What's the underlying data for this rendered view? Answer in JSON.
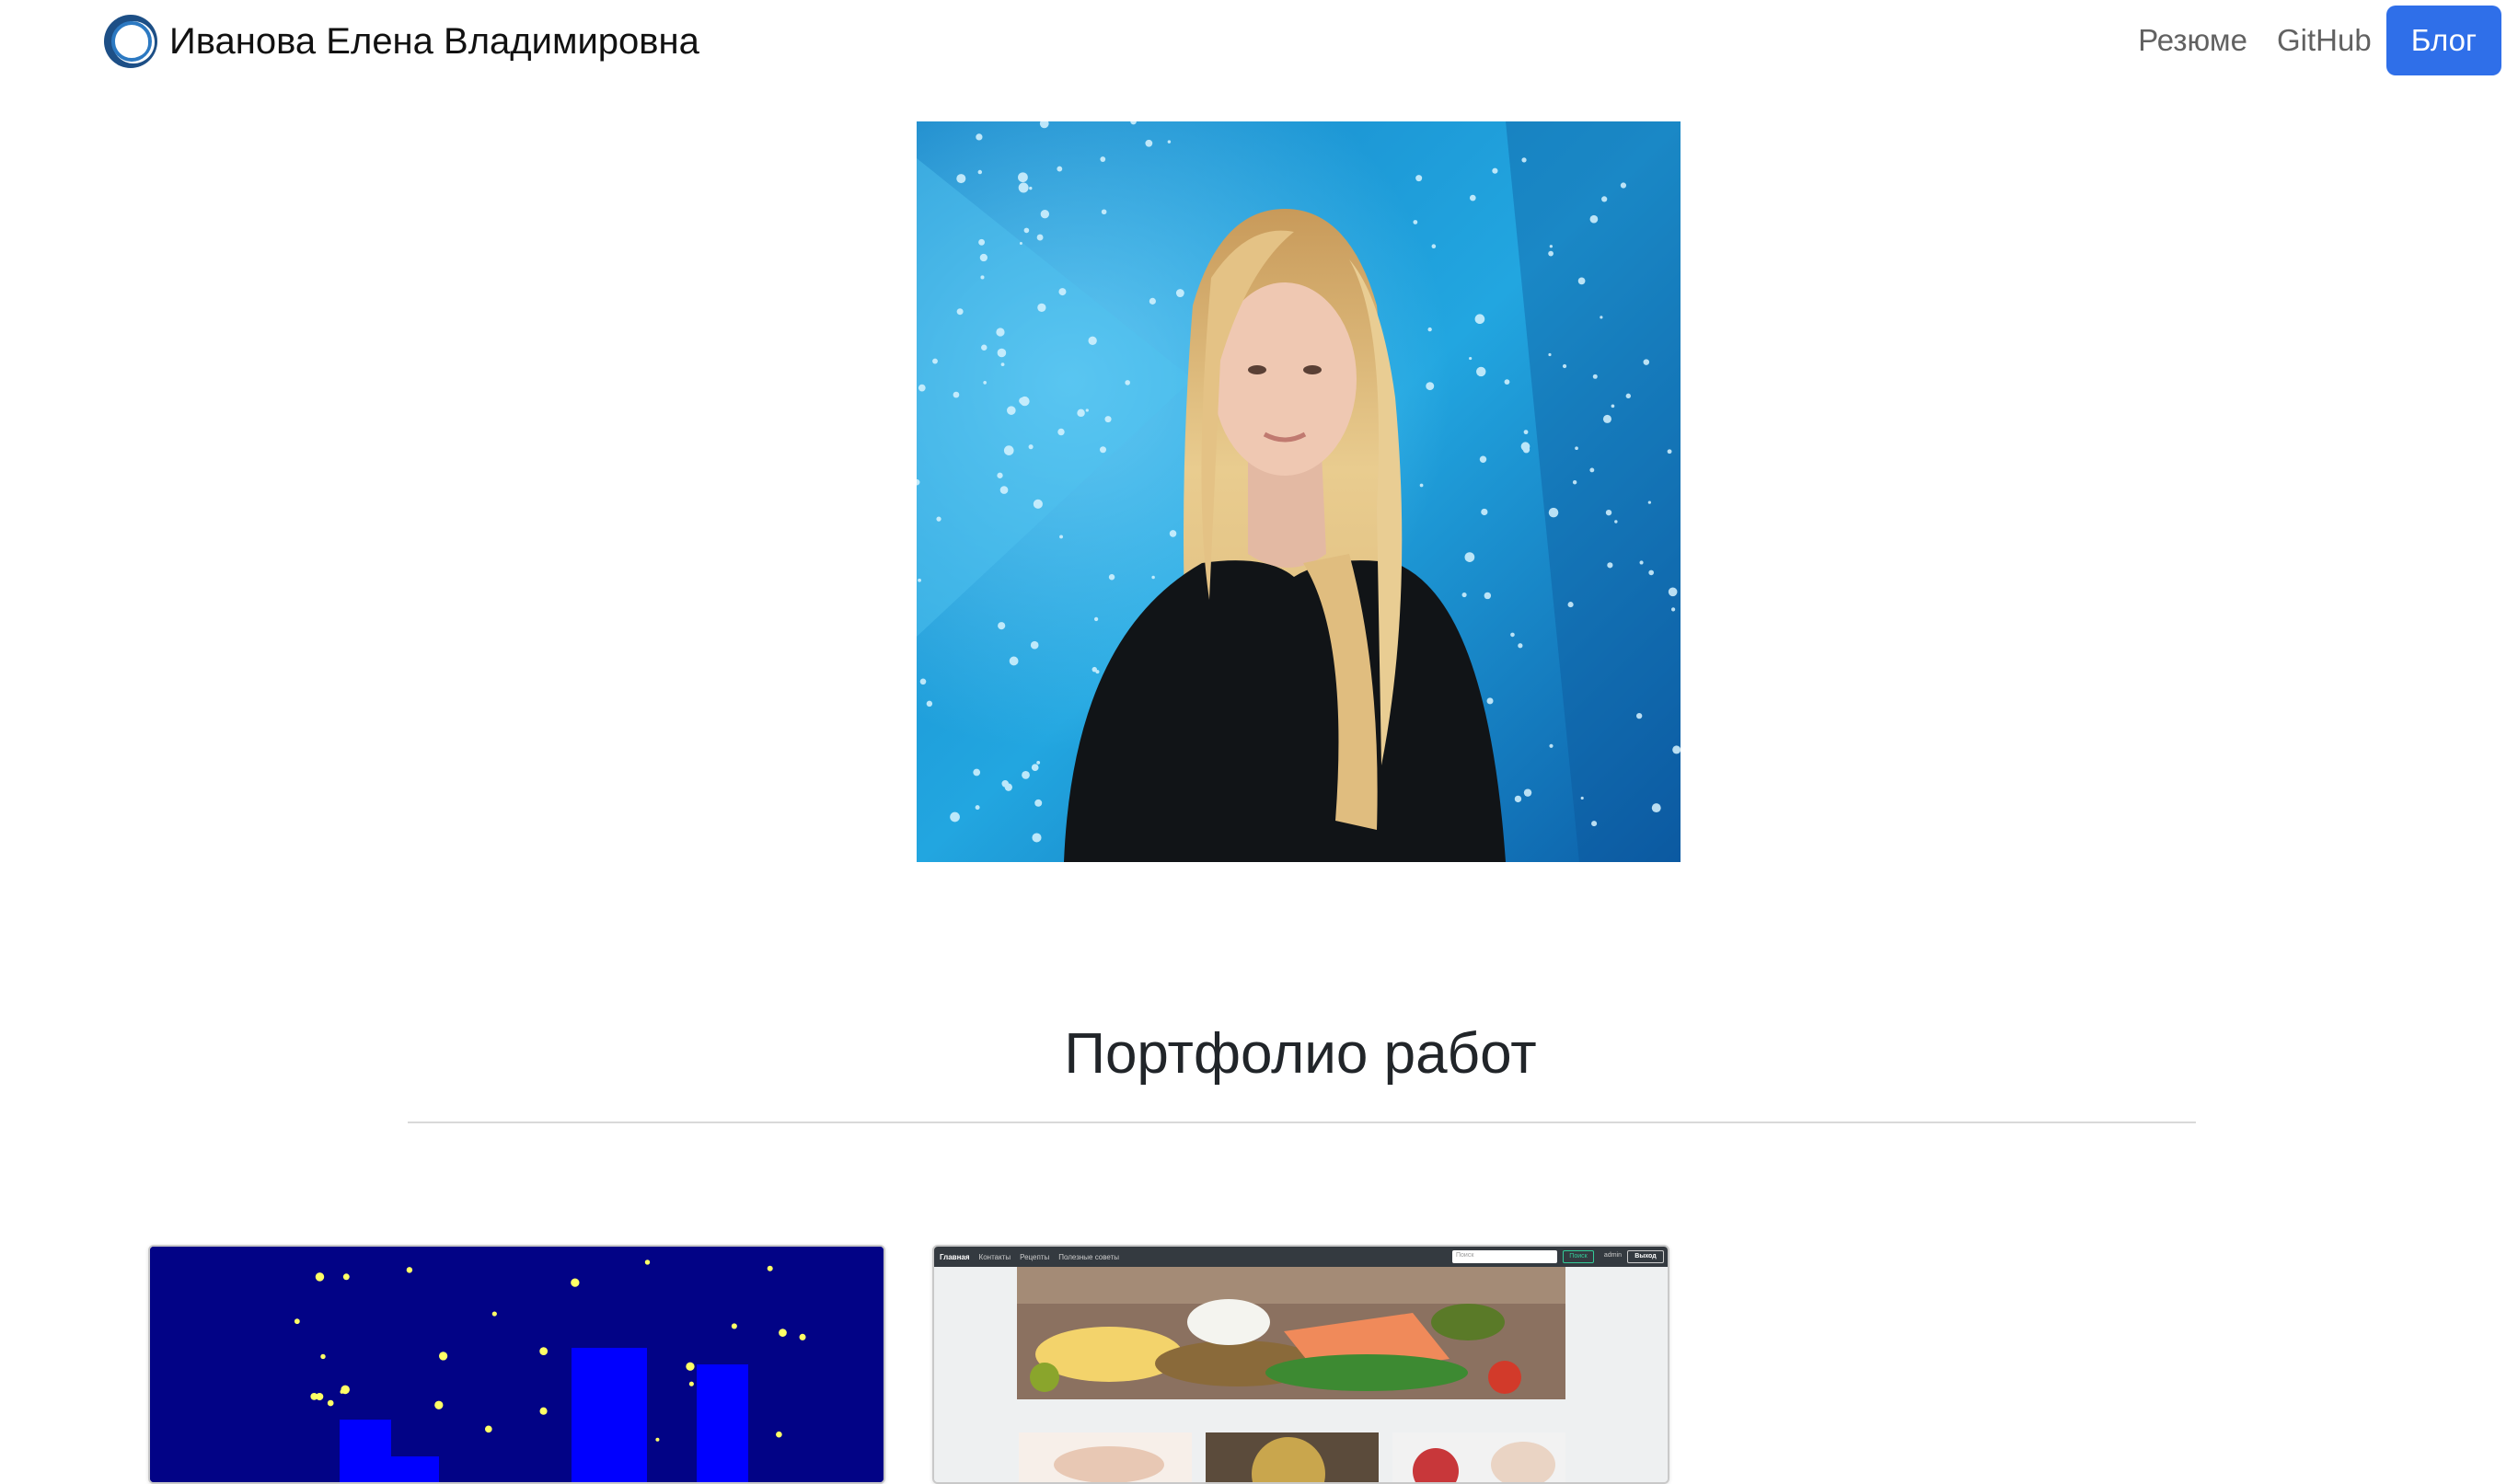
{
  "header": {
    "brand_name": "Иванова Елена Владимировна",
    "nav": {
      "resume": "Резюме",
      "github": "GitHub",
      "blog": "Блог"
    },
    "accent_color": "#2f6fe9"
  },
  "hero": {
    "photo_icon": "profile-photo"
  },
  "portfolio": {
    "title": "Портфолио работ",
    "cards": [
      {
        "thumbnail": "night-city-scene"
      },
      {
        "thumbnail": "healthy-food-website",
        "mini_nav": {
          "items": [
            "Главная",
            "Контакты",
            "Рецепты",
            "Полезные советы"
          ],
          "search_placeholder": "Поиск",
          "search_button": "Поиск",
          "user": "admin",
          "logout": "Выход"
        }
      }
    ]
  }
}
